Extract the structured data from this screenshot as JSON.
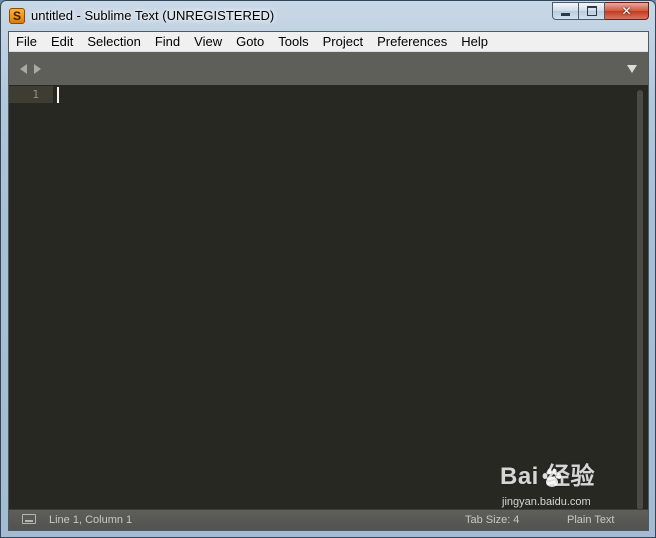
{
  "window": {
    "title": "untitled - Sublime Text (UNREGISTERED)",
    "app_icon_letter": "S"
  },
  "menu": {
    "items": [
      "File",
      "Edit",
      "Selection",
      "Find",
      "View",
      "Goto",
      "Tools",
      "Project",
      "Preferences",
      "Help"
    ]
  },
  "editor": {
    "line_numbers": [
      "1"
    ],
    "content": ""
  },
  "statusbar": {
    "position": "Line 1, Column 1",
    "tab_size": "Tab Size: 4",
    "syntax": "Plain Text"
  },
  "watermark": {
    "logo": "Bai  经验",
    "url": "jingyan.baidu.com"
  },
  "colors": {
    "editor_bg": "#272822",
    "gutter_text": "#8f908a",
    "tabbar_bg": "#5f5f59",
    "status_text": "#c8c8c0",
    "caret": "#f8f8f0"
  },
  "icons": {
    "app": "sublime-text-logo",
    "minimize": "minimize-icon",
    "maximize": "maximize-icon",
    "close": "close-icon",
    "nav_left": "arrow-left-icon",
    "nav_right": "arrow-right-icon",
    "tab_dropdown": "dropdown-triangle-icon",
    "status_console": "console-icon"
  }
}
